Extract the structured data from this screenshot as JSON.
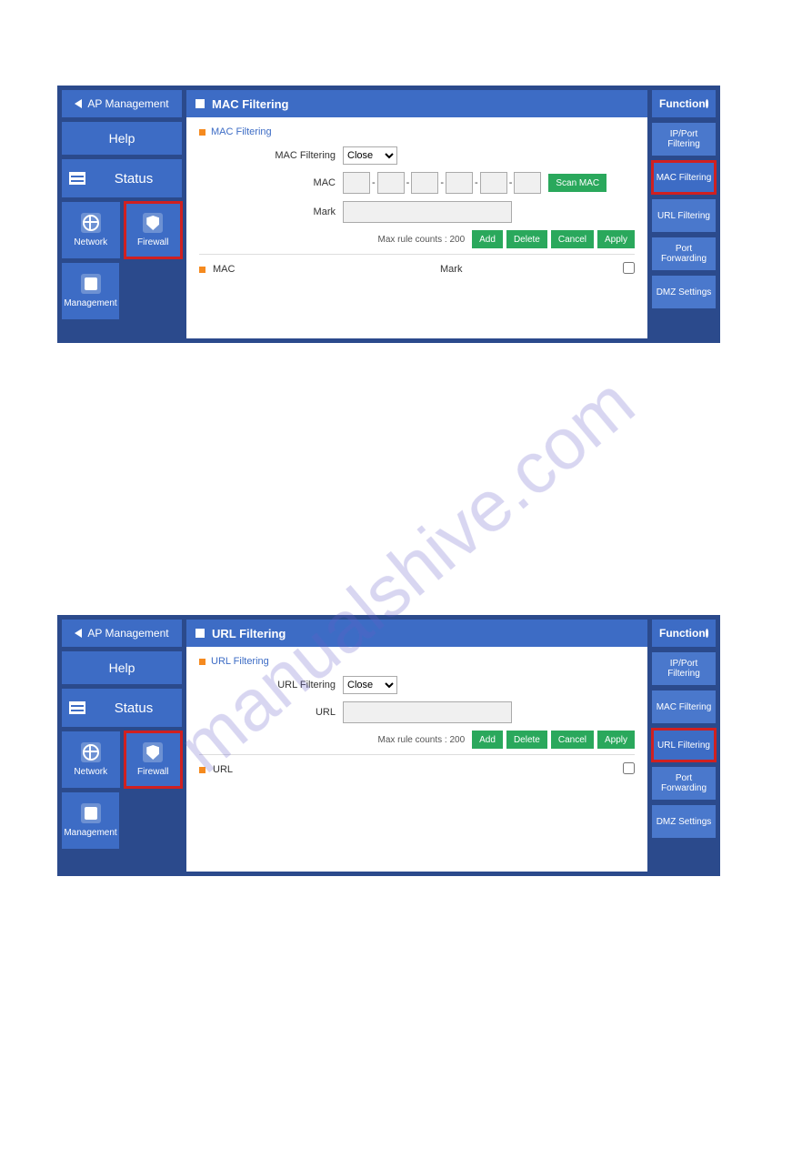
{
  "watermark": "manualshive.com",
  "panel1": {
    "left": {
      "ap": "AP Management",
      "help": "Help",
      "status": "Status",
      "tiles": {
        "network": "Network",
        "firewall": "Firewall",
        "management": "Management"
      }
    },
    "title": "MAC Filtering",
    "section": "MAC Filtering",
    "form": {
      "macfilt_lbl": "MAC Filtering",
      "macfilt_val": "Close",
      "mac_lbl": "MAC",
      "scan": "Scan MAC",
      "mark_lbl": "Mark"
    },
    "actions": {
      "count_lbl": "Max rule counts :",
      "count": "200",
      "add": "Add",
      "del": "Delete",
      "cancel": "Cancel",
      "apply": "Apply"
    },
    "list": {
      "c1": "MAC",
      "c2": "Mark"
    },
    "right": {
      "head": "Function",
      "items": [
        "IP/Port Filtering",
        "MAC Filtering",
        "URL Filtering",
        "Port Forwarding",
        "DMZ Settings"
      ]
    }
  },
  "panel2": {
    "left": {
      "ap": "AP Management",
      "help": "Help",
      "status": "Status",
      "tiles": {
        "network": "Network",
        "firewall": "Firewall",
        "management": "Management"
      }
    },
    "title": "URL Filtering",
    "section": "URL Filtering",
    "form": {
      "urlfilt_lbl": "URL Filtering",
      "urlfilt_val": "Close",
      "url_lbl": "URL"
    },
    "actions": {
      "count_lbl": "Max rule counts :",
      "count": "200",
      "add": "Add",
      "del": "Delete",
      "cancel": "Cancel",
      "apply": "Apply"
    },
    "list": {
      "c1": "URL"
    },
    "right": {
      "head": "Function",
      "items": [
        "IP/Port Filtering",
        "MAC Filtering",
        "URL Filtering",
        "Port Forwarding",
        "DMZ Settings"
      ]
    }
  }
}
